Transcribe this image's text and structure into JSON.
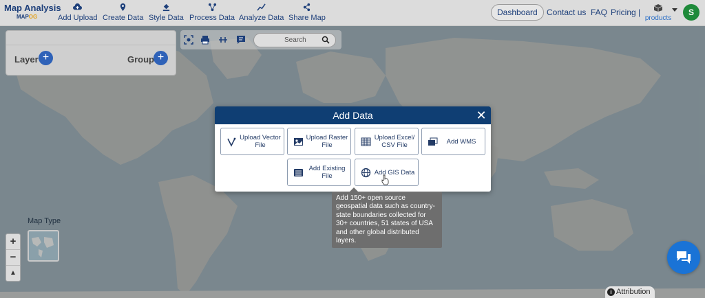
{
  "brand": {
    "title": "Map Analysis",
    "sub_a": "MAP",
    "sub_b": "OG"
  },
  "nav": [
    {
      "label": "Add Upload",
      "icon": "cloud-upload-icon"
    },
    {
      "label": "Create Data",
      "icon": "map-pin-icon"
    },
    {
      "label": "Style Data",
      "icon": "paint-bucket-icon"
    },
    {
      "label": "Process Data",
      "icon": "process-icon"
    },
    {
      "label": "Analyze Data",
      "icon": "analyze-icon"
    },
    {
      "label": "Share Map",
      "icon": "share-icon"
    }
  ],
  "header": {
    "dashboard": "Dashboard",
    "contact": "Contact us",
    "faq": "FAQ",
    "pricing": "Pricing |",
    "products": "products",
    "avatar_initial": "S"
  },
  "layer_panel": {
    "layer_label": "Layer",
    "group_label": "Group"
  },
  "search": {
    "placeholder": "Search"
  },
  "map_type": {
    "label": "Map Type"
  },
  "zoom": {
    "in": "+",
    "out": "−"
  },
  "modal": {
    "title": "Add Data",
    "close": "✕",
    "tiles": [
      {
        "label": "Upload Vector File",
        "icon": "vector-icon"
      },
      {
        "label": "Upload Raster File",
        "icon": "raster-image-icon"
      },
      {
        "label": "Upload Excel/ CSV File",
        "icon": "spreadsheet-icon"
      },
      {
        "label": "Add WMS",
        "icon": "wms-icon"
      },
      {
        "label": "Add Existing File",
        "icon": "existing-file-icon"
      },
      {
        "label": "Add GIS Data",
        "icon": "globe-icon"
      }
    ]
  },
  "tooltip": {
    "text": "Add 150+ open source geospatial data such as country-state boundaries collected for 30+ countries, 51 states of USA and other global distributed layers."
  },
  "attribution": {
    "label": "Attribution"
  },
  "colors": {
    "brand": "#1d3f7a",
    "modal_header": "#0f3e73",
    "accent": "#2f62b8",
    "avatar": "#1e8a3a",
    "chat": "#1a73d6"
  }
}
